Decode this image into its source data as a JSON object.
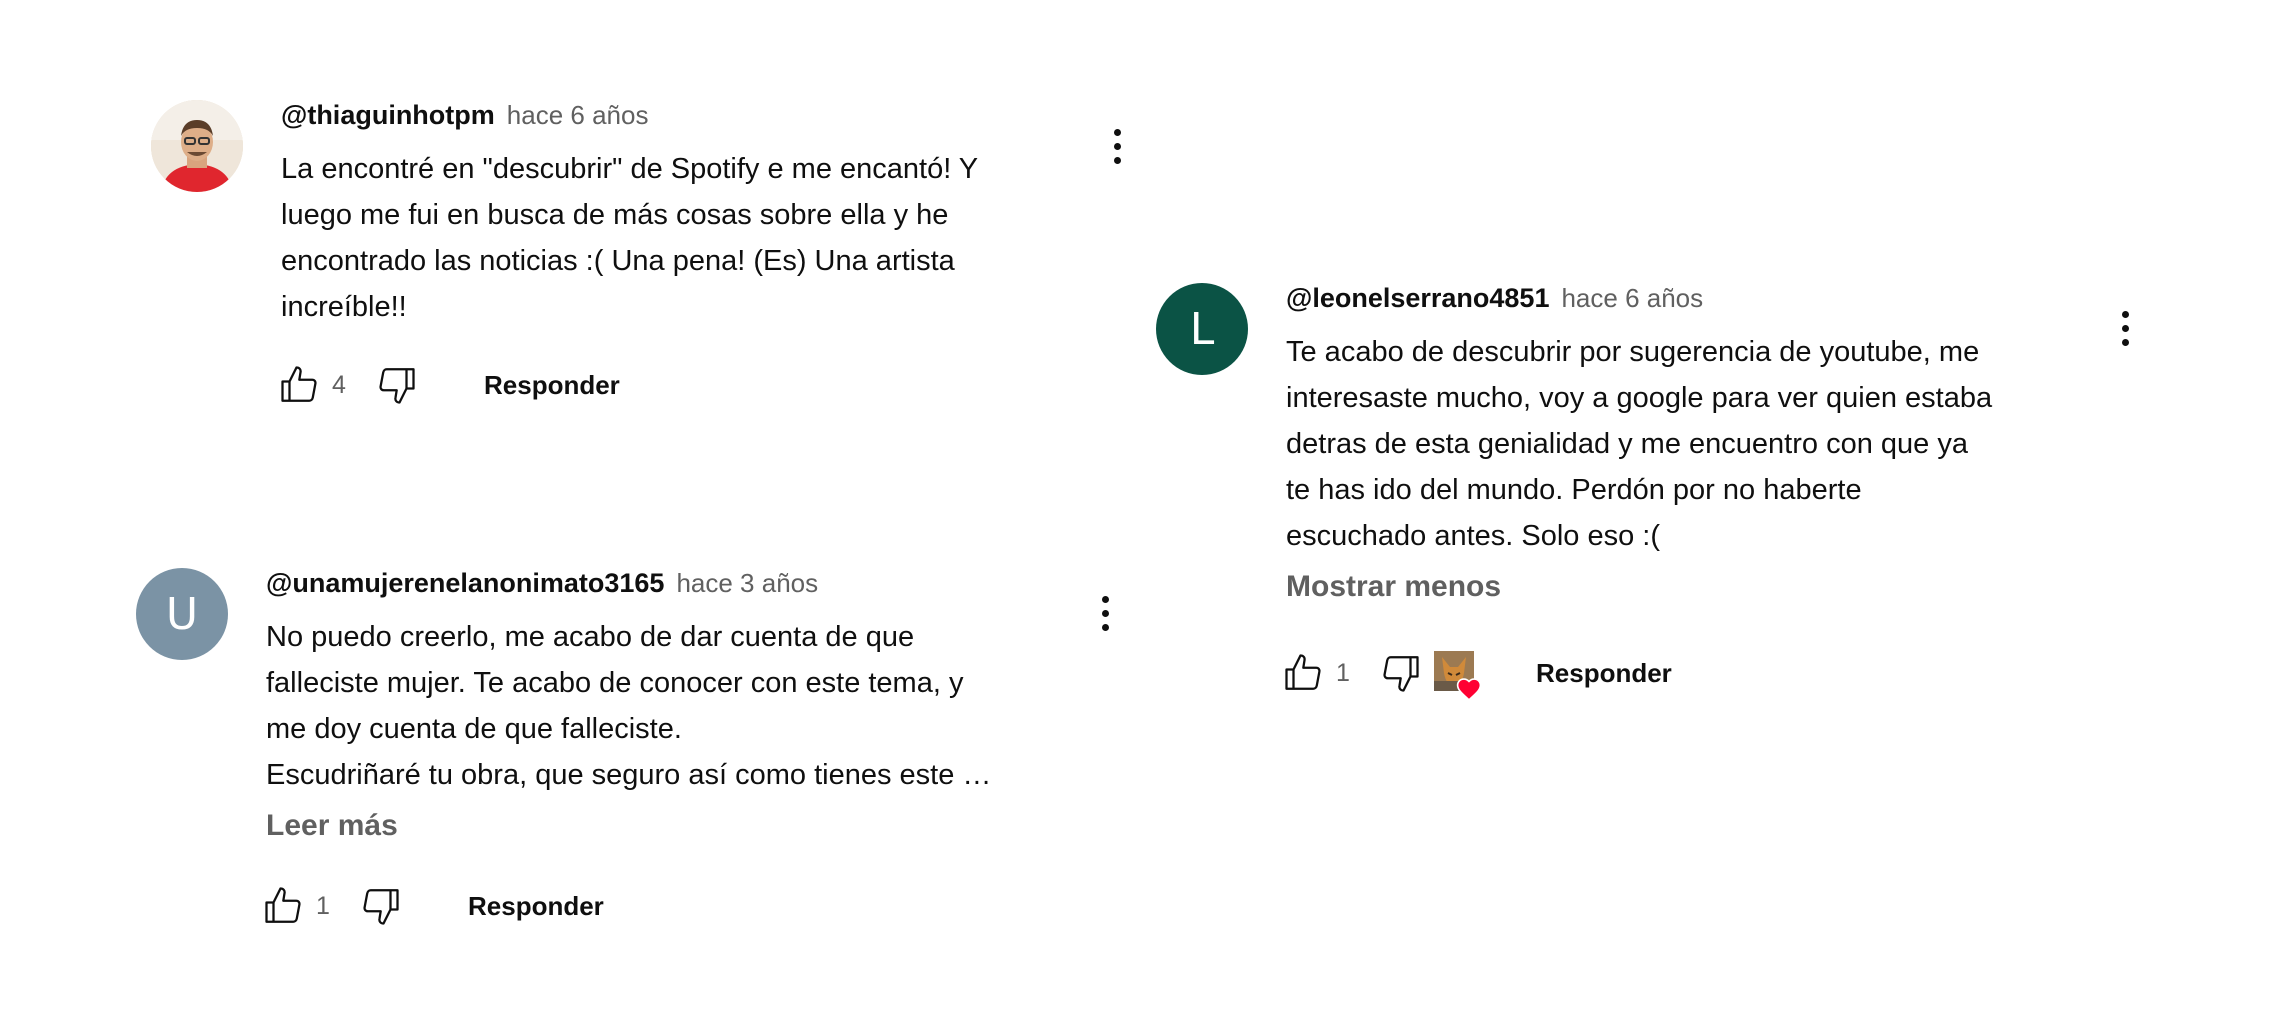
{
  "colors": {
    "avatar_u": "#7b93a5",
    "avatar_l": "#0b5345",
    "heart": "#ff0033"
  },
  "comments": [
    {
      "author": "@thiaguinhotpm",
      "time": "hace 6 años",
      "text": "La encontré en \"descubrir\" de Spotify e me encantó! Y\nluego me fui en busca de más cosas sobre ella y he\nencontrado las noticias :( Una pena! (Es) Una artista\nincreíble!!",
      "likes": "4",
      "reply_label": "Responder",
      "avatar_icon": "user-photo"
    },
    {
      "author": "@unamujerenelanonimato3165",
      "time": "hace 3 años",
      "text": "No puedo creerlo, me acabo de dar cuenta de que\nfalleciste mujer. Te acabo de conocer con este tema, y\nme doy cuenta de que falleciste.\nEscudriñaré tu obra, que seguro así como tienes este …",
      "more_label": "Leer más",
      "likes": "1",
      "reply_label": "Responder",
      "avatar_letter": "U"
    },
    {
      "author": "@leonelserrano4851",
      "time": "hace 6 años",
      "text": "Te acabo de descubrir por sugerencia de youtube, me\ninteresaste mucho, voy a google para ver quien estaba\ndetras de esta genialidad y me encuentro con que ya\nte has ido del mundo. Perdón por no haberte\nescuchado antes. Solo eso :(",
      "more_label": "Mostrar menos",
      "likes": "1",
      "reply_label": "Responder",
      "avatar_letter": "L",
      "creator_heart": true
    }
  ]
}
